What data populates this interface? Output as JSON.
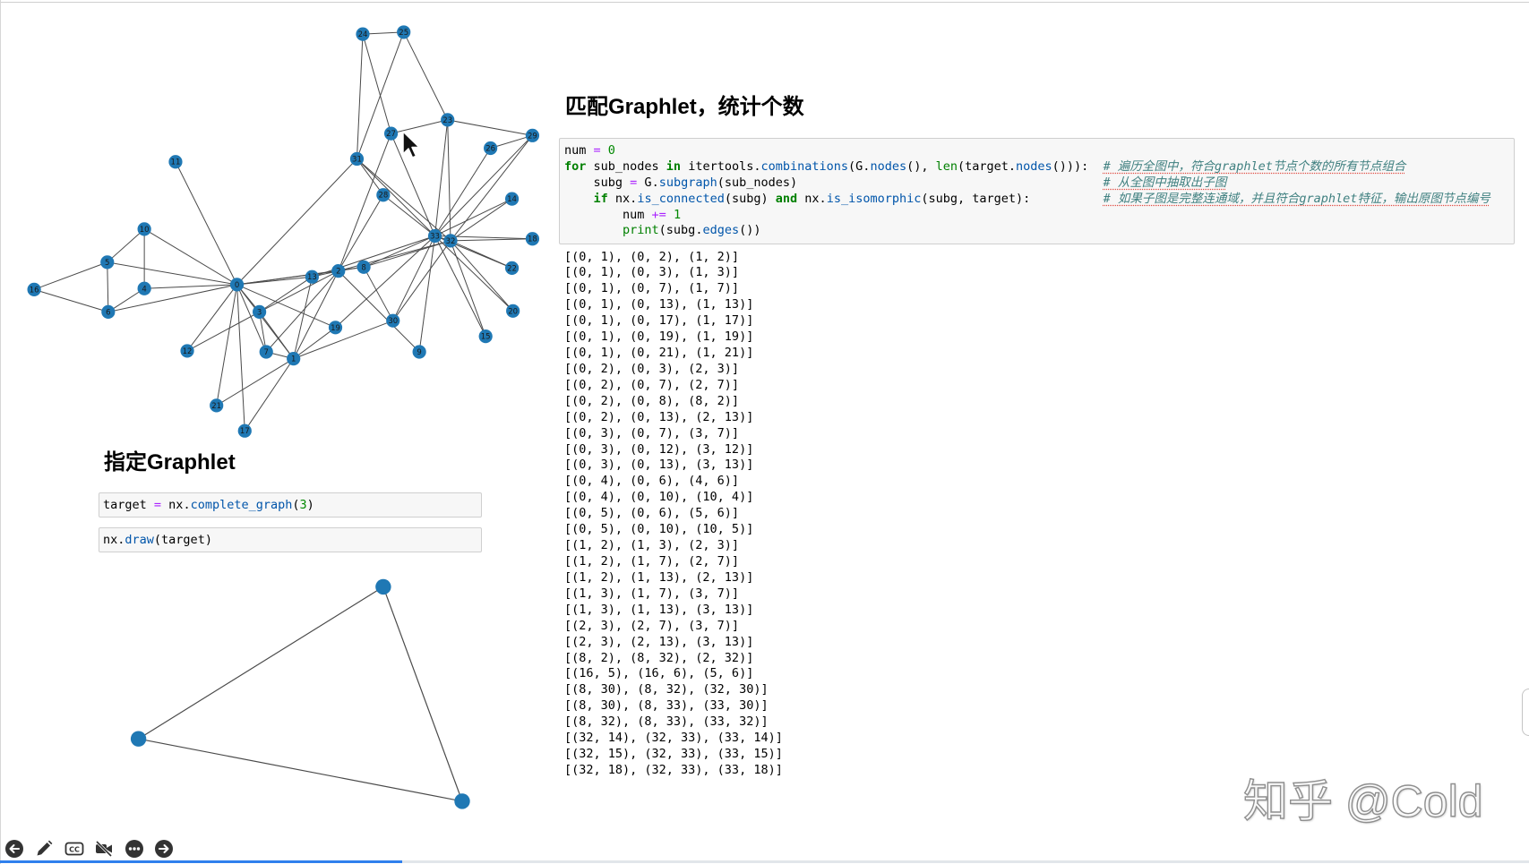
{
  "headings": {
    "match": "匹配Graphlet，统计个数",
    "target": "指定Graphlet"
  },
  "cells": {
    "count": {
      "source": [
        "num = 0",
        "for sub_nodes in itertools.combinations(G.nodes(), len(target.nodes())):  # 遍历全图中，符合graphlet节点个数的所有节点组合",
        "    subg = G.subgraph(sub_nodes)                                          # 从全图中抽取出子图",
        "    if nx.is_connected(subg) and nx.is_isomorphic(subg, target):          # 如果子图是完整连通域，并且符合graphlet特征，输出原图节点编号",
        "        num += 1",
        "        print(subg.edges())"
      ],
      "output": [
        "[(0, 1), (0, 2), (1, 2)]",
        "[(0, 1), (0, 3), (1, 3)]",
        "[(0, 1), (0, 7), (1, 7)]",
        "[(0, 1), (0, 13), (1, 13)]",
        "[(0, 1), (0, 17), (1, 17)]",
        "[(0, 1), (0, 19), (1, 19)]",
        "[(0, 1), (0, 21), (1, 21)]",
        "[(0, 2), (0, 3), (2, 3)]",
        "[(0, 2), (0, 7), (2, 7)]",
        "[(0, 2), (0, 8), (8, 2)]",
        "[(0, 2), (0, 13), (2, 13)]",
        "[(0, 3), (0, 7), (3, 7)]",
        "[(0, 3), (0, 12), (3, 12)]",
        "[(0, 3), (0, 13), (3, 13)]",
        "[(0, 4), (0, 6), (4, 6)]",
        "[(0, 4), (0, 10), (10, 4)]",
        "[(0, 5), (0, 6), (5, 6)]",
        "[(0, 5), (0, 10), (10, 5)]",
        "[(1, 2), (1, 3), (2, 3)]",
        "[(1, 2), (1, 7), (2, 7)]",
        "[(1, 2), (1, 13), (2, 13)]",
        "[(1, 3), (1, 7), (3, 7)]",
        "[(1, 3), (1, 13), (3, 13)]",
        "[(2, 3), (2, 7), (3, 7)]",
        "[(2, 3), (2, 13), (3, 13)]",
        "[(8, 2), (8, 32), (2, 32)]",
        "[(16, 5), (16, 6), (5, 6)]",
        "[(8, 30), (8, 32), (32, 30)]",
        "[(8, 30), (8, 33), (33, 30)]",
        "[(8, 32), (8, 33), (33, 32)]",
        "[(32, 14), (32, 33), (33, 14)]",
        "[(32, 15), (32, 33), (33, 15)]",
        "[(32, 18), (32, 33), (33, 18)]"
      ]
    },
    "define_target": {
      "source": [
        "target = nx.complete_graph(3)"
      ]
    },
    "draw_target": {
      "source": [
        "nx.draw(target)"
      ]
    }
  },
  "graph": {
    "nodes": [
      "0",
      "1",
      "2",
      "3",
      "4",
      "5",
      "6",
      "7",
      "8",
      "9",
      "10",
      "11",
      "12",
      "13",
      "14",
      "15",
      "16",
      "17",
      "18",
      "19",
      "20",
      "21",
      "22",
      "23",
      "24",
      "25",
      "26",
      "27",
      "28",
      "29",
      "30",
      "31",
      "32",
      "33"
    ],
    "edges": [
      [
        0,
        1
      ],
      [
        0,
        2
      ],
      [
        0,
        3
      ],
      [
        0,
        4
      ],
      [
        0,
        5
      ],
      [
        0,
        6
      ],
      [
        0,
        7
      ],
      [
        0,
        8
      ],
      [
        0,
        10
      ],
      [
        0,
        11
      ],
      [
        0,
        12
      ],
      [
        0,
        13
      ],
      [
        0,
        17
      ],
      [
        0,
        19
      ],
      [
        0,
        21
      ],
      [
        0,
        31
      ],
      [
        1,
        2
      ],
      [
        1,
        3
      ],
      [
        1,
        7
      ],
      [
        1,
        13
      ],
      [
        1,
        17
      ],
      [
        1,
        19
      ],
      [
        1,
        21
      ],
      [
        1,
        30
      ],
      [
        2,
        3
      ],
      [
        2,
        7
      ],
      [
        2,
        8
      ],
      [
        2,
        9
      ],
      [
        2,
        13
      ],
      [
        2,
        27
      ],
      [
        2,
        28
      ],
      [
        2,
        32
      ],
      [
        3,
        7
      ],
      [
        3,
        12
      ],
      [
        3,
        13
      ],
      [
        4,
        6
      ],
      [
        4,
        10
      ],
      [
        5,
        6
      ],
      [
        5,
        10
      ],
      [
        5,
        16
      ],
      [
        6,
        16
      ],
      [
        8,
        30
      ],
      [
        8,
        32
      ],
      [
        8,
        33
      ],
      [
        9,
        33
      ],
      [
        13,
        33
      ],
      [
        14,
        32
      ],
      [
        14,
        33
      ],
      [
        15,
        32
      ],
      [
        15,
        33
      ],
      [
        18,
        32
      ],
      [
        18,
        33
      ],
      [
        19,
        33
      ],
      [
        20,
        32
      ],
      [
        20,
        33
      ],
      [
        22,
        32
      ],
      [
        22,
        33
      ],
      [
        23,
        25
      ],
      [
        23,
        27
      ],
      [
        23,
        29
      ],
      [
        23,
        32
      ],
      [
        23,
        33
      ],
      [
        24,
        25
      ],
      [
        24,
        27
      ],
      [
        24,
        31
      ],
      [
        25,
        31
      ],
      [
        26,
        29
      ],
      [
        26,
        33
      ],
      [
        27,
        33
      ],
      [
        28,
        31
      ],
      [
        28,
        33
      ],
      [
        29,
        32
      ],
      [
        29,
        33
      ],
      [
        30,
        32
      ],
      [
        30,
        33
      ],
      [
        31,
        32
      ],
      [
        31,
        33
      ],
      [
        32,
        33
      ]
    ]
  },
  "target_graph": {
    "nodes": [
      0,
      1,
      2
    ],
    "edges": [
      [
        0,
        1
      ],
      [
        0,
        2
      ],
      [
        1,
        2
      ]
    ]
  },
  "colors": {
    "node": "#1f78b4",
    "edge": "#4a4a4a",
    "progress": "#2f80ed"
  },
  "toolbar": {
    "icons": [
      "prev-icon",
      "pen-icon",
      "cc-icon",
      "camera-off-icon",
      "more-icon",
      "next-icon"
    ],
    "cc_label": "CC"
  },
  "playback_progress": 0.263,
  "watermark": "知乎 @Cold"
}
